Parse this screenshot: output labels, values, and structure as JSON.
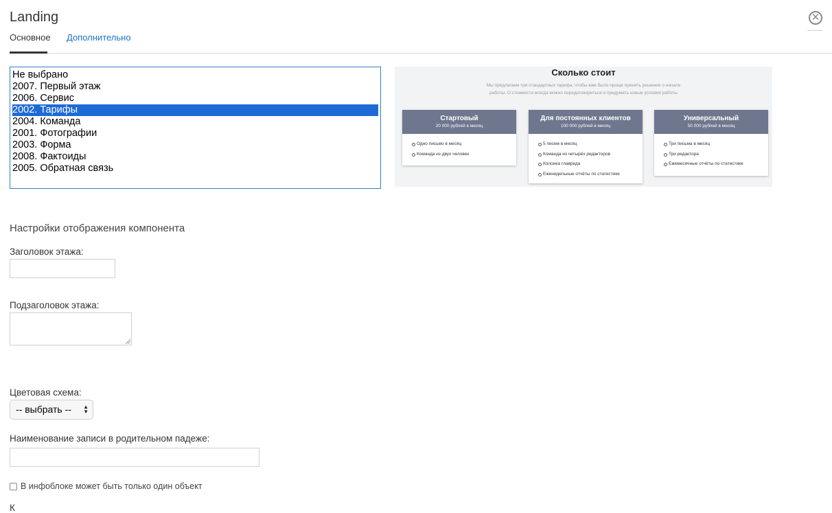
{
  "window": {
    "title": "Landing"
  },
  "tabs": [
    {
      "label": "Основное",
      "active": true
    },
    {
      "label": "Дополнительно",
      "active": false
    }
  ],
  "floors_list": {
    "options": [
      "Не выбрано",
      "2007. Первый этаж",
      "2006. Сервис",
      "2002. Тарифы",
      "2004. Команда",
      "2001. Фотографии",
      "2003. Форма",
      "2008. Фактоиды",
      "2005. Обратная связь"
    ],
    "selected": "2002. Тарифы"
  },
  "preview": {
    "title": "Сколько стоит",
    "subtitle": "Мы предлагаем три стандартных тарифа, чтобы вам было проще принять решение о начале работы. О стоимости всегда можно передоговориться и придумать новые условия работы",
    "cards": [
      {
        "name": "Стартовый",
        "price": "20 000 рублей в месяц",
        "features": [
          "Одно письмо в месяц",
          "Команда из двух человек"
        ]
      },
      {
        "name": "Для постоянных клиентов",
        "price": "100 000 рублей в месяц",
        "features": [
          "5 писем в месяц",
          "Команда из четырёх редакторов",
          "Колонка главреда",
          "Еженедельные отчёты по статистике"
        ]
      },
      {
        "name": "Универсальный",
        "price": "50 000 рублей в месяц",
        "features": [
          "Три письма в месяц",
          "Три редактора",
          "Ежемесячные отчёты по статистике"
        ]
      }
    ],
    "colors": {
      "card_header": "#6e778e",
      "background": "#f2f3f5"
    }
  },
  "settings": {
    "section_title": "Настройки отображения компонента",
    "floor_title_label": "Заголовок этажа:",
    "floor_title_value": "",
    "floor_subtitle_label": "Подзаголовок этажа:",
    "floor_subtitle_value": "",
    "color_scheme_label": "Цветовая схема:",
    "color_scheme_value": "-- выбрать --",
    "genitive_name_label": "Наименование записи в родительном падеже:",
    "genitive_name_value": "",
    "single_object_label": "В инфоблоке может быть только один объект",
    "single_object_checked": false,
    "next_label_fragment": "К"
  },
  "icons": {
    "close": "close-circle-icon",
    "select_arrows": "up-down-arrows-icon",
    "resize": "resize-grip-icon"
  },
  "colors": {
    "accent": "#1a73c8",
    "selection": "#1e6ad6",
    "list_border": "#2a7fc4"
  }
}
